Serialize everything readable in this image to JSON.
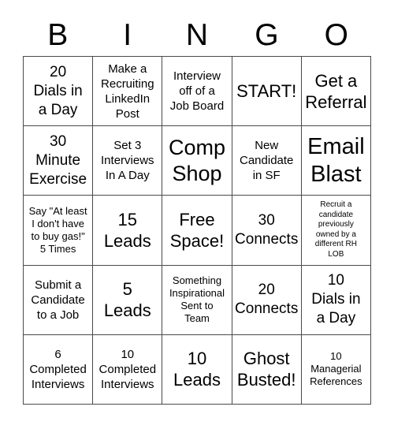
{
  "card": {
    "title_letters": [
      "B",
      "I",
      "N",
      "G",
      "O"
    ],
    "grid_size": "5x5",
    "colors": {
      "background": "#ffffff",
      "text": "#000000",
      "grid_line": "#4a4a4a"
    }
  },
  "cells": [
    {
      "id": "b1",
      "text": "20\nDials in\na Day",
      "size": "lg"
    },
    {
      "id": "i1",
      "text": "Make a\nRecruiting\nLinkedIn\nPost",
      "size": "md"
    },
    {
      "id": "n1",
      "text": "Interview\noff of a\nJob Board",
      "size": "md"
    },
    {
      "id": "g1",
      "text": "START!",
      "size": "xl"
    },
    {
      "id": "o1",
      "text": "Get a\nReferral",
      "size": "xl"
    },
    {
      "id": "b2",
      "text": "30\nMinute\nExercise",
      "size": "lg"
    },
    {
      "id": "i2",
      "text": "Set 3\nInterviews\nIn A Day",
      "size": "md"
    },
    {
      "id": "n2",
      "text": "Comp\nShop",
      "size": "xxl"
    },
    {
      "id": "g2",
      "text": "New\nCandidate\nin SF",
      "size": "md"
    },
    {
      "id": "o2",
      "text": "Email\nBlast",
      "size": "hg"
    },
    {
      "id": "b3",
      "text": "Say \"At least\nI don't have\nto buy gas!\"\n5 Times",
      "size": "sm"
    },
    {
      "id": "i3",
      "text": "15\nLeads",
      "size": "xl"
    },
    {
      "id": "n3",
      "text": "Free\nSpace!",
      "size": "xl"
    },
    {
      "id": "g3",
      "text": "30\nConnects",
      "size": "lg"
    },
    {
      "id": "o3",
      "text": "Recruit a\ncandidate\npreviously\nowned by a\ndifferent RH\nLOB",
      "size": "xs"
    },
    {
      "id": "b4",
      "text": "Submit a\nCandidate\nto a Job",
      "size": "md"
    },
    {
      "id": "i4",
      "text": "5\nLeads",
      "size": "xl"
    },
    {
      "id": "n4",
      "text": "Something\nInspirational\nSent to\nTeam",
      "size": "sm"
    },
    {
      "id": "g4",
      "text": "20\nConnects",
      "size": "lg"
    },
    {
      "id": "o4",
      "text": "10\nDials in\na Day",
      "size": "lg"
    },
    {
      "id": "b5",
      "text": "6\nCompleted\nInterviews",
      "size": "md"
    },
    {
      "id": "i5",
      "text": "10\nCompleted\nInterviews",
      "size": "md"
    },
    {
      "id": "n5",
      "text": "10\nLeads",
      "size": "xl"
    },
    {
      "id": "g5",
      "text": "Ghost\nBusted!",
      "size": "xl"
    },
    {
      "id": "o5",
      "text": "10\nManagerial\nReferences",
      "size": "sm"
    }
  ]
}
